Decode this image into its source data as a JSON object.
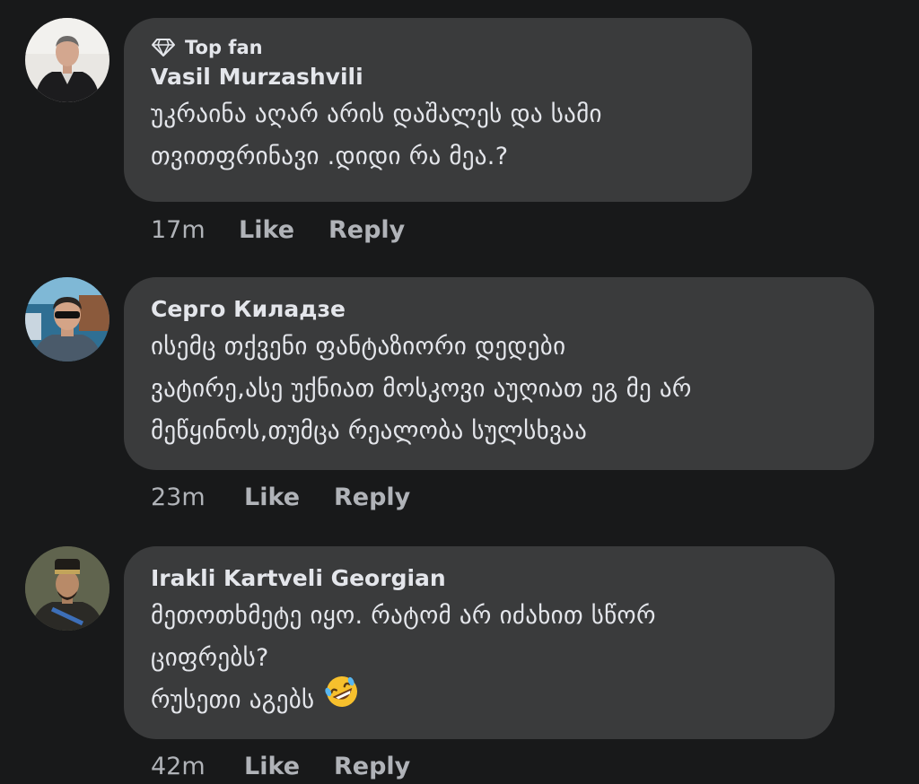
{
  "comments": [
    {
      "badge": "Top fan",
      "badge_icon": "diamond-icon",
      "author": "Vasil Murzashvili",
      "lines": [
        "უკრაინა აღარ არის დაშალეს და სამი",
        "თვითფრინავი .დიდი რა მეა.?"
      ],
      "time": "17m",
      "like": "Like",
      "reply": "Reply"
    },
    {
      "author": "Серго Киладзе",
      "lines": [
        "ისემც თქვენი ფანტაზიორი დედები",
        "ვატირე,ასე უქნიათ მოსკოვი აუღიათ ეგ მე არ",
        "მეწყინოს,თუმცა რეალობა სულსხვაა"
      ],
      "time": "23m",
      "like": "Like",
      "reply": "Reply"
    },
    {
      "author": "Irakli Kartveli Georgian",
      "lines": [
        "მეთოთხმეტე იყო. რატომ არ იძახით სწორ",
        "ციფრებს?",
        "რუსეთი აგებს"
      ],
      "emoji": "rolling-on-floor-laughing-emoji",
      "time": "42m",
      "like": "Like",
      "reply": "Reply"
    }
  ],
  "colors": {
    "background": "#18191a",
    "bubble": "#3a3b3c",
    "primary_text": "#e4e6eb",
    "secondary_text": "#b0b3b8"
  }
}
